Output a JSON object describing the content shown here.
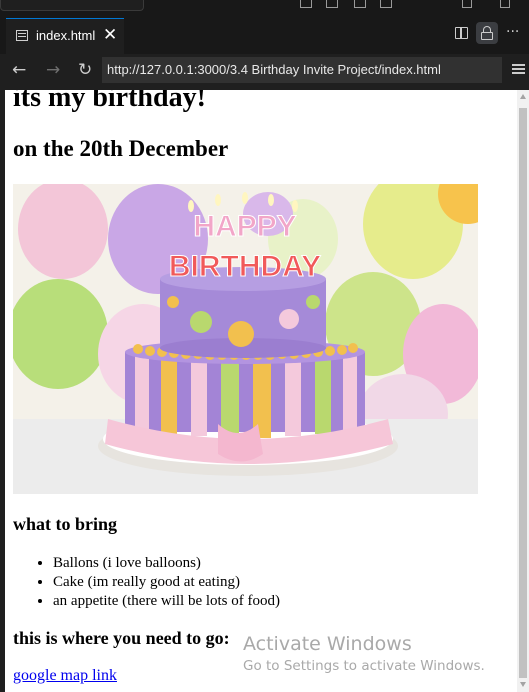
{
  "tab": {
    "title": "index.html",
    "close_glyph": "✕"
  },
  "address_bar": {
    "url": "http://127.0.0.1:3000/3.4 Birthday Invite Project/index.html"
  },
  "page": {
    "heading": "its my birthday!",
    "subheading": "on the 20th December",
    "cake_image_text": {
      "line1": "HAPPY",
      "line2": "BIRTHDAY"
    },
    "bring_heading": "what to bring",
    "bring_items": [
      "Ballons (i love balloons)",
      "Cake (im really good at eating)",
      "an appetite (there will be lots of food)"
    ],
    "location_heading": "this is where you need to go:",
    "map_link": "google map link"
  },
  "watermark": {
    "title": "Activate Windows",
    "subtitle": "Go to Settings to activate Windows."
  },
  "icons": [
    "file-icon",
    "close-icon",
    "split-editor-icon",
    "lock-icon",
    "more-icon",
    "back-icon",
    "forward-icon",
    "reload-icon",
    "menu-icon"
  ],
  "colors": {
    "accent": "#0078d4",
    "link": "#0000ee",
    "chrome": "#1f1f1f"
  }
}
